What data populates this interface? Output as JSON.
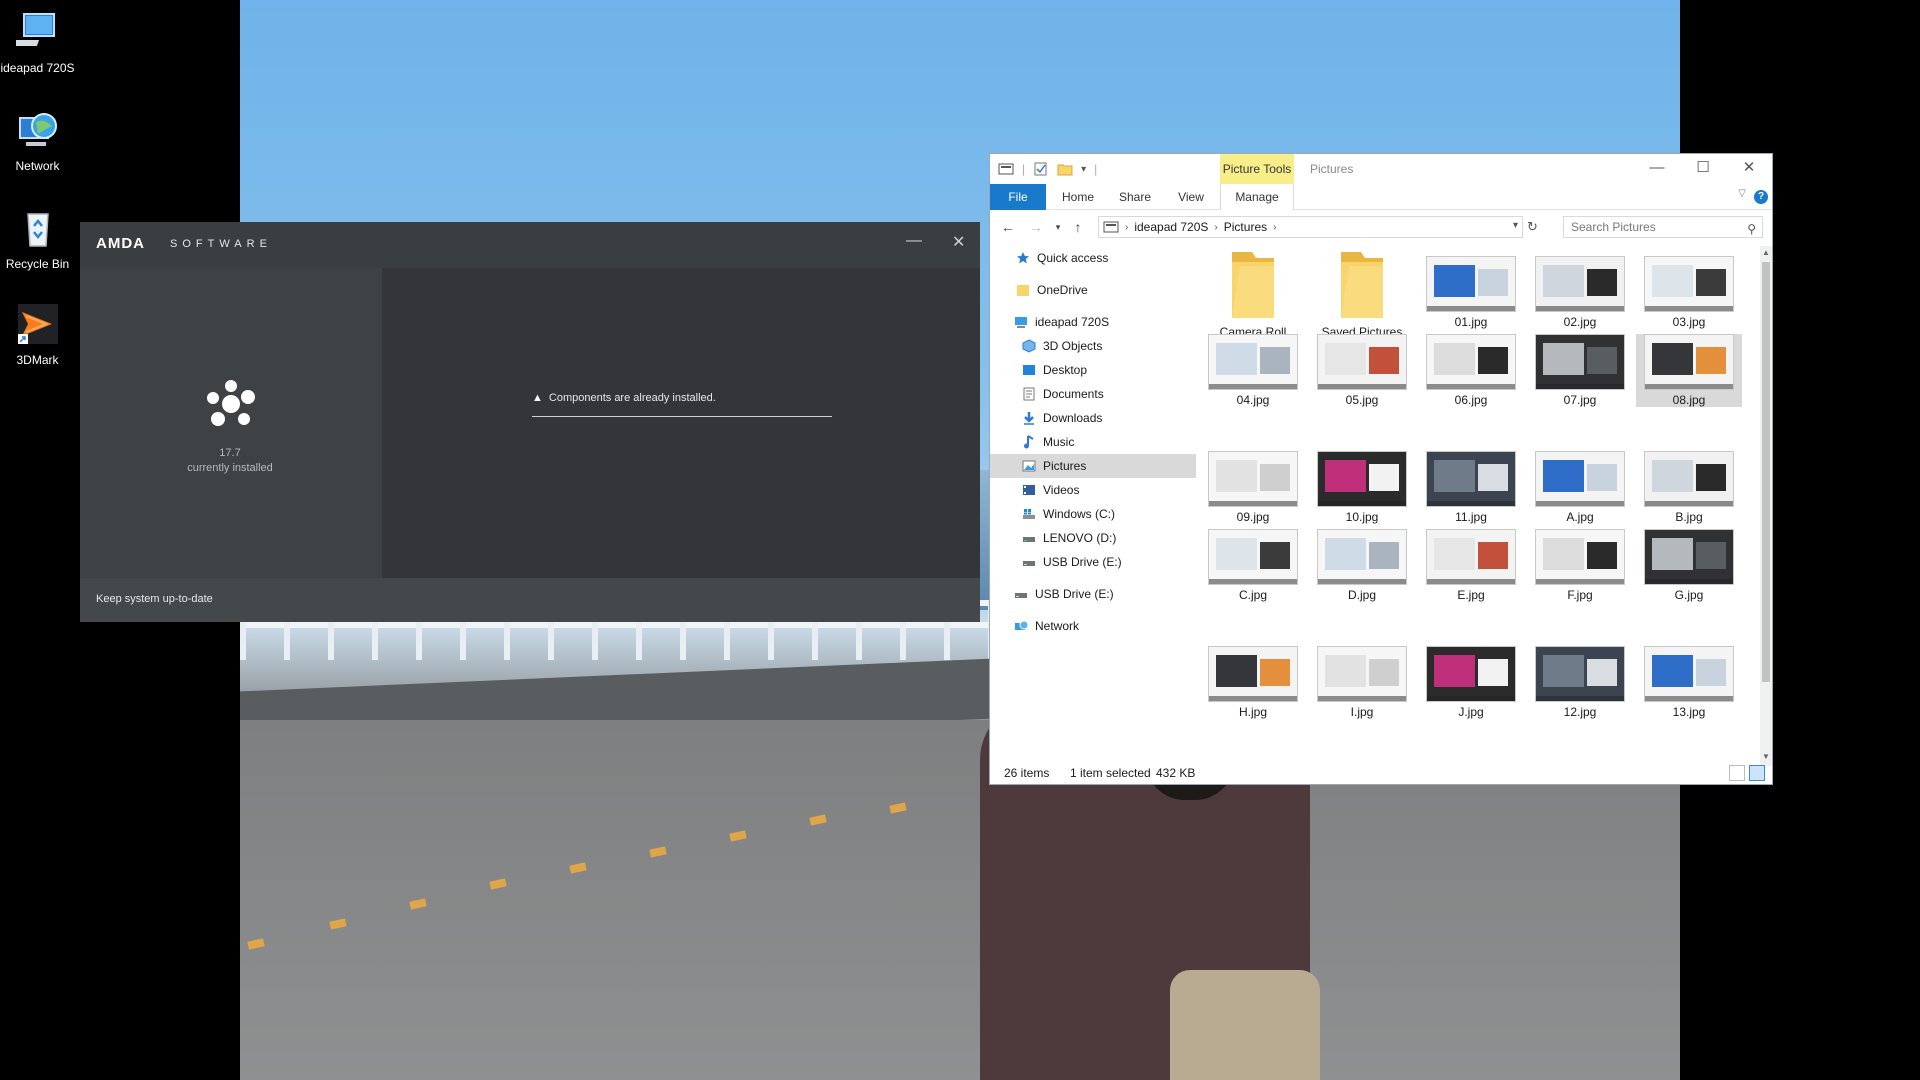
{
  "desktop": {
    "icons": [
      {
        "label": "ideapad 720S",
        "icon": "computer-icon"
      },
      {
        "label": "Network",
        "icon": "network-globe-icon"
      },
      {
        "label": "Recycle Bin",
        "icon": "recycle-bin-icon"
      },
      {
        "label": "3DMark",
        "icon": "3dmark-icon"
      }
    ]
  },
  "amd": {
    "logo": "AMDA",
    "software": "SOFTWARE",
    "minimize": "—",
    "close": "✕",
    "version": "17.7",
    "version_status": "currently installed",
    "message": "Components are already installed.",
    "footer": "Keep system up-to-date"
  },
  "explorer": {
    "context_tab": "Picture Tools",
    "title": "Pictures",
    "window_controls": {
      "minimize": "—",
      "maximize": "☐",
      "close": "✕"
    },
    "ribbon_tabs": {
      "file": "File",
      "home": "Home",
      "share": "Share",
      "view": "View",
      "manage": "Manage"
    },
    "address": {
      "root": "ideapad 720S",
      "current": "Pictures"
    },
    "search_placeholder": "Search Pictures",
    "nav": {
      "quick_access": "Quick access",
      "onedrive": "OneDrive",
      "this_pc": "ideapad 720S",
      "objects3d": "3D Objects",
      "desktop": "Desktop",
      "documents": "Documents",
      "downloads": "Downloads",
      "music": "Music",
      "pictures": "Pictures",
      "videos": "Videos",
      "windows_c": "Windows (C:)",
      "lenovo_d": "LENOVO (D:)",
      "usb_e_sub": "USB Drive (E:)",
      "usb_e": "USB Drive (E:)",
      "network": "Network"
    },
    "items": [
      {
        "name": "Camera Roll",
        "kind": "folder"
      },
      {
        "name": "Saved Pictures",
        "kind": "folder"
      },
      {
        "name": "01.jpg",
        "kind": "image"
      },
      {
        "name": "02.jpg",
        "kind": "image"
      },
      {
        "name": "03.jpg",
        "kind": "image"
      },
      {
        "name": "04.jpg",
        "kind": "image"
      },
      {
        "name": "05.jpg",
        "kind": "image"
      },
      {
        "name": "06.jpg",
        "kind": "image"
      },
      {
        "name": "07.jpg",
        "kind": "image"
      },
      {
        "name": "08.jpg",
        "kind": "image",
        "selected": true
      },
      {
        "name": "09.jpg",
        "kind": "image"
      },
      {
        "name": "10.jpg",
        "kind": "image"
      },
      {
        "name": "11.jpg",
        "kind": "image"
      },
      {
        "name": "A.jpg",
        "kind": "image"
      },
      {
        "name": "B.jpg",
        "kind": "image"
      },
      {
        "name": "C.jpg",
        "kind": "image"
      },
      {
        "name": "D.jpg",
        "kind": "image"
      },
      {
        "name": "E.jpg",
        "kind": "image"
      },
      {
        "name": "F.jpg",
        "kind": "image"
      },
      {
        "name": "G.jpg",
        "kind": "image"
      },
      {
        "name": "H.jpg",
        "kind": "image"
      },
      {
        "name": "I.jpg",
        "kind": "image"
      },
      {
        "name": "J.jpg",
        "kind": "image"
      },
      {
        "name": "12.jpg",
        "kind": "image"
      },
      {
        "name": "13.jpg",
        "kind": "image"
      }
    ],
    "status": {
      "count": "26 items",
      "selection": "1 item selected",
      "size": "432 KB"
    }
  }
}
